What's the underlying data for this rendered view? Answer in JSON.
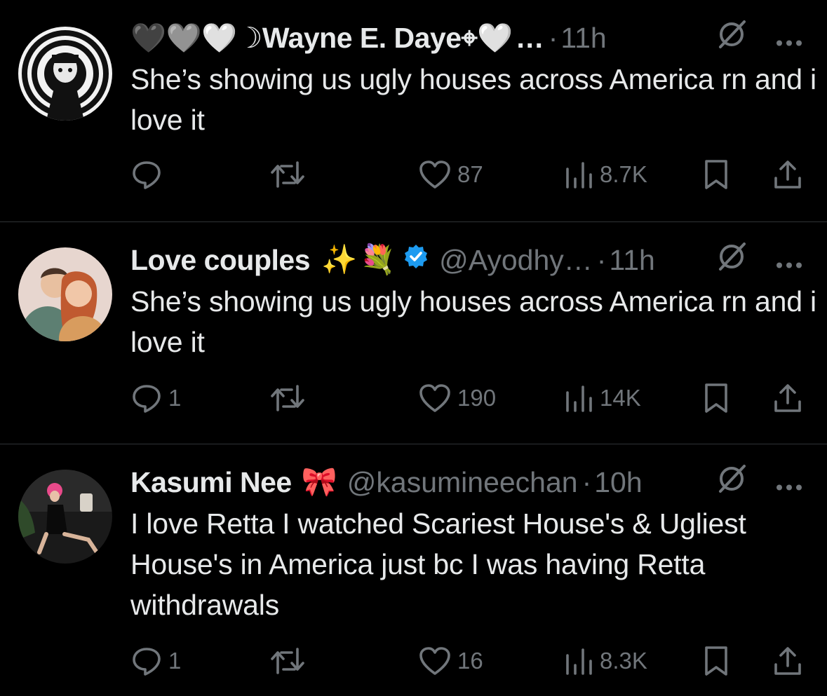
{
  "posts": [
    {
      "name": "🖤🩶🤍☽Wayne E. Daye⌖🤍",
      "handle": "…",
      "time": "11h",
      "text": "She’s showing us ugly houses across America rn and i love it",
      "replies": "",
      "likes": "87",
      "views": "8.7K",
      "verified": false
    },
    {
      "name": "Love couples",
      "emoji": [
        "✨",
        "💐"
      ],
      "handle": "@Ayodhy…",
      "time": "11h",
      "text": "She’s showing us ugly houses across America rn and i love it",
      "replies": "1",
      "likes": "190",
      "views": "14K",
      "verified": true,
      "verified_color": "#1d9bf0"
    },
    {
      "name": "Kasumi Nee",
      "emoji": [
        "🎀"
      ],
      "handle": "@kasumineechan",
      "time": "10h",
      "text": "I love Retta I watched Scariest House's & Ugliest House's in America just bc I was having Retta withdrawals",
      "replies": "1",
      "likes": "16",
      "views": "8.3K",
      "verified": false
    }
  ],
  "separator": "·",
  "icons": [
    "reply-icon",
    "repost-icon",
    "like-icon",
    "views-icon",
    "bookmark-icon",
    "share-icon",
    "grok-icon",
    "more-icon"
  ],
  "colors": {
    "background": "#000000",
    "text": "#e7e9ea",
    "muted": "#71767b",
    "divider": "#2f3336"
  }
}
